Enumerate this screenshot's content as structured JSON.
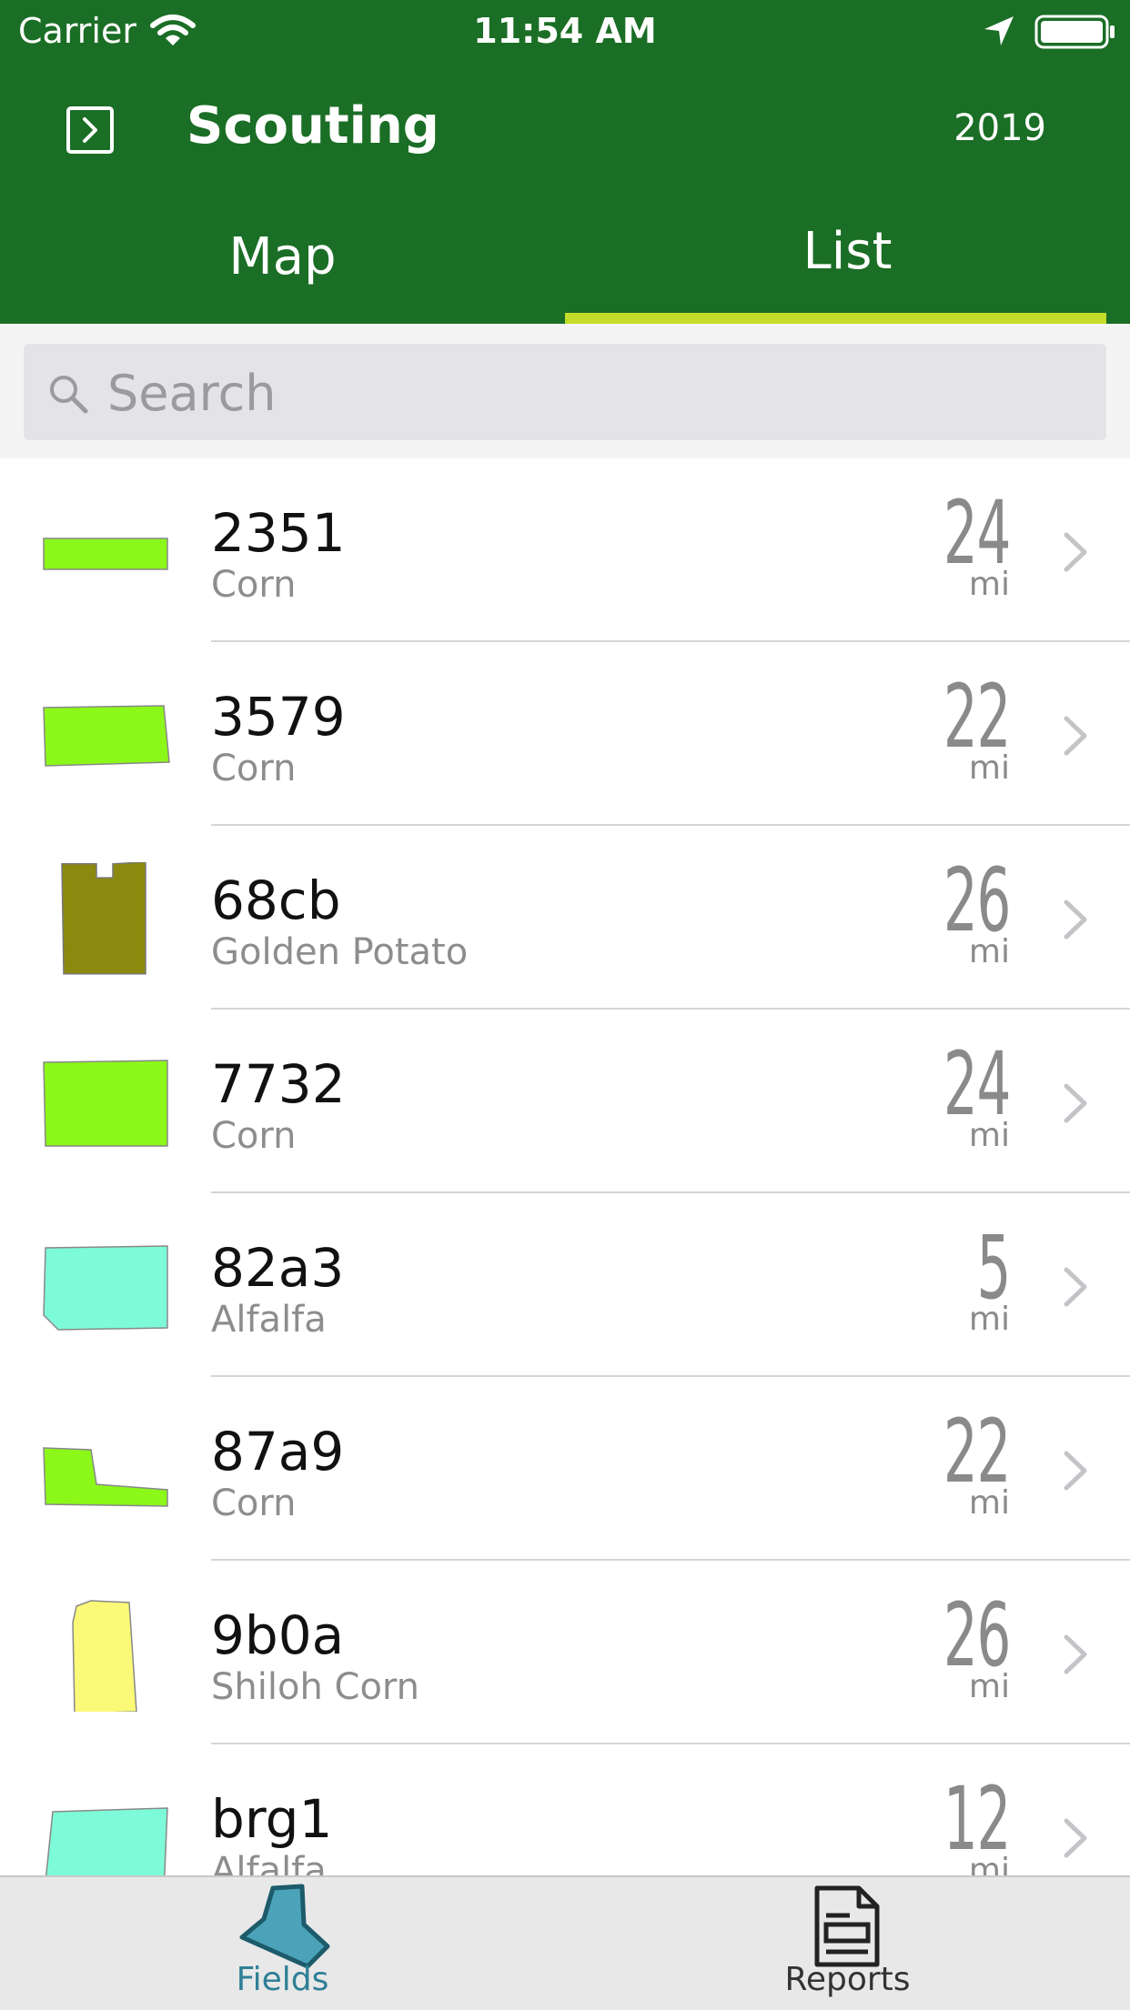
{
  "status_bar": {
    "carrier": "Carrier",
    "time": "11:54 AM"
  },
  "app_bar": {
    "title": "Scouting",
    "year": "2019"
  },
  "tabs": [
    {
      "label": "Map",
      "active": false
    },
    {
      "label": "List",
      "active": true
    }
  ],
  "search": {
    "placeholder": "Search",
    "value": ""
  },
  "fields": [
    {
      "name": "2351",
      "crop": "Corn",
      "distance": "24",
      "unit": "mi",
      "color": "#8cf81a"
    },
    {
      "name": "3579",
      "crop": "Corn",
      "distance": "22",
      "unit": "mi",
      "color": "#8cf81a"
    },
    {
      "name": "68cb",
      "crop": "Golden Potato",
      "distance": "26",
      "unit": "mi",
      "color": "#8b8a0e"
    },
    {
      "name": "7732",
      "crop": "Corn",
      "distance": "24",
      "unit": "mi",
      "color": "#8cf81a"
    },
    {
      "name": "82a3",
      "crop": "Alfalfa",
      "distance": "5",
      "unit": "mi",
      "color": "#7dfbd8"
    },
    {
      "name": "87a9",
      "crop": "Corn",
      "distance": "22",
      "unit": "mi",
      "color": "#8cf81a"
    },
    {
      "name": "9b0a",
      "crop": "Shiloh Corn",
      "distance": "26",
      "unit": "mi",
      "color": "#fbfa78"
    },
    {
      "name": "brg1",
      "crop": "Alfalfa",
      "distance": "12",
      "unit": "mi",
      "color": "#7dfbd8"
    }
  ],
  "bottom_tabs": [
    {
      "label": "Fields",
      "icon": "field-icon",
      "active": true,
      "color": "#2f7f96"
    },
    {
      "label": "Reports",
      "icon": "report-icon",
      "active": false
    }
  ],
  "colors": {
    "header": "#1a6e25",
    "tab_indicator": "#c5dd2a"
  }
}
